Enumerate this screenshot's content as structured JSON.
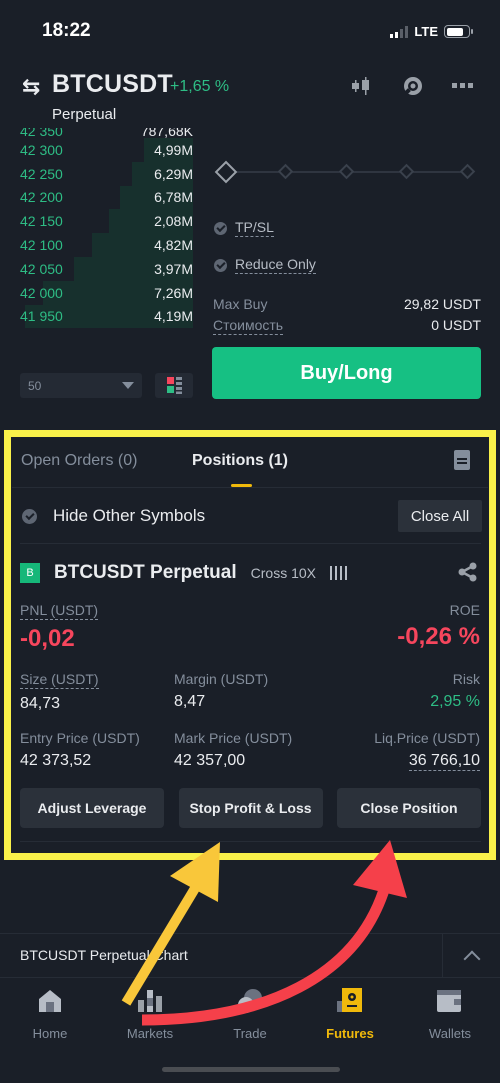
{
  "status_bar": {
    "time": "18:22",
    "network": "LTE"
  },
  "header": {
    "symbol": "BTCUSDT",
    "change": "+1,65 %",
    "contract_type": "Perpetual",
    "icons": [
      "chart-candles-icon",
      "settings-icon",
      "more-icon"
    ]
  },
  "orderbook": {
    "partial_row": {
      "price": "42 350",
      "qty": "787,68K"
    },
    "rows": [
      {
        "price": "42 300",
        "qty": "4,99M",
        "depth": 0.28
      },
      {
        "price": "42 250",
        "qty": "6,29M",
        "depth": 0.35
      },
      {
        "price": "42 200",
        "qty": "6,78M",
        "depth": 0.42
      },
      {
        "price": "42 150",
        "qty": "2,08M",
        "depth": 0.48
      },
      {
        "price": "42 100",
        "qty": "4,82M",
        "depth": 0.58
      },
      {
        "price": "42 050",
        "qty": "3,97M",
        "depth": 0.68
      },
      {
        "price": "42 000",
        "qty": "7,26M",
        "depth": 0.86
      },
      {
        "price": "41 950",
        "qty": "4,19M",
        "depth": 0.96
      }
    ],
    "depth_select": "50"
  },
  "order_form": {
    "leverage_slider_value": 0,
    "tpsl_label": "TP/SL",
    "reduce_only_label": "Reduce Only",
    "max_buy_label": "Max Buy",
    "max_buy_value": "29,82 USDT",
    "cost_label": "Стоимость",
    "cost_value": "0 USDT",
    "buy_button": "Buy/Long"
  },
  "tabs": {
    "open_orders": "Open Orders (0)",
    "positions": "Positions (1)"
  },
  "filter": {
    "hide_other_symbols": "Hide Other Symbols",
    "close_all": "Close All"
  },
  "position": {
    "badge": "B",
    "name": "BTCUSDT Perpetual",
    "margin_mode": "Cross 10X",
    "pnl_label": "PNL (USDT)",
    "pnl_value": "-0,02",
    "roe_label": "ROE",
    "roe_value": "-0,26 %",
    "size_label": "Size (USDT)",
    "size_value": "84,73",
    "margin_label": "Margin (USDT)",
    "margin_value": "8,47",
    "risk_label": "Risk",
    "risk_value": "2,95 %",
    "entry_label": "Entry Price (USDT)",
    "entry_value": "42 373,52",
    "mark_label": "Mark Price (USDT)",
    "mark_value": "42 357,00",
    "liq_label": "Liq.Price (USDT)",
    "liq_value": "36 766,10",
    "actions": {
      "adjust_leverage": "Adjust Leverage",
      "stop_profit_loss": "Stop Profit & Loss",
      "close_position": "Close Position"
    }
  },
  "chart_bar": {
    "label": "BTCUSDT Perpetual Chart"
  },
  "bottom_nav": {
    "items": [
      {
        "label": "Home",
        "icon": "home-icon"
      },
      {
        "label": "Markets",
        "icon": "markets-icon"
      },
      {
        "label": "Trade",
        "icon": "trade-icon"
      },
      {
        "label": "Futures",
        "icon": "futures-icon",
        "active": true
      },
      {
        "label": "Wallets",
        "icon": "wallets-icon"
      }
    ]
  },
  "colors": {
    "background": "#1a1f28",
    "green": "#2ebd85",
    "red": "#f6465d",
    "accent_yellow": "#f0b90b",
    "highlight_border": "#f9f14a",
    "annotation_arrow_yellow": "#f9c73a",
    "annotation_arrow_red": "#f5404a"
  }
}
